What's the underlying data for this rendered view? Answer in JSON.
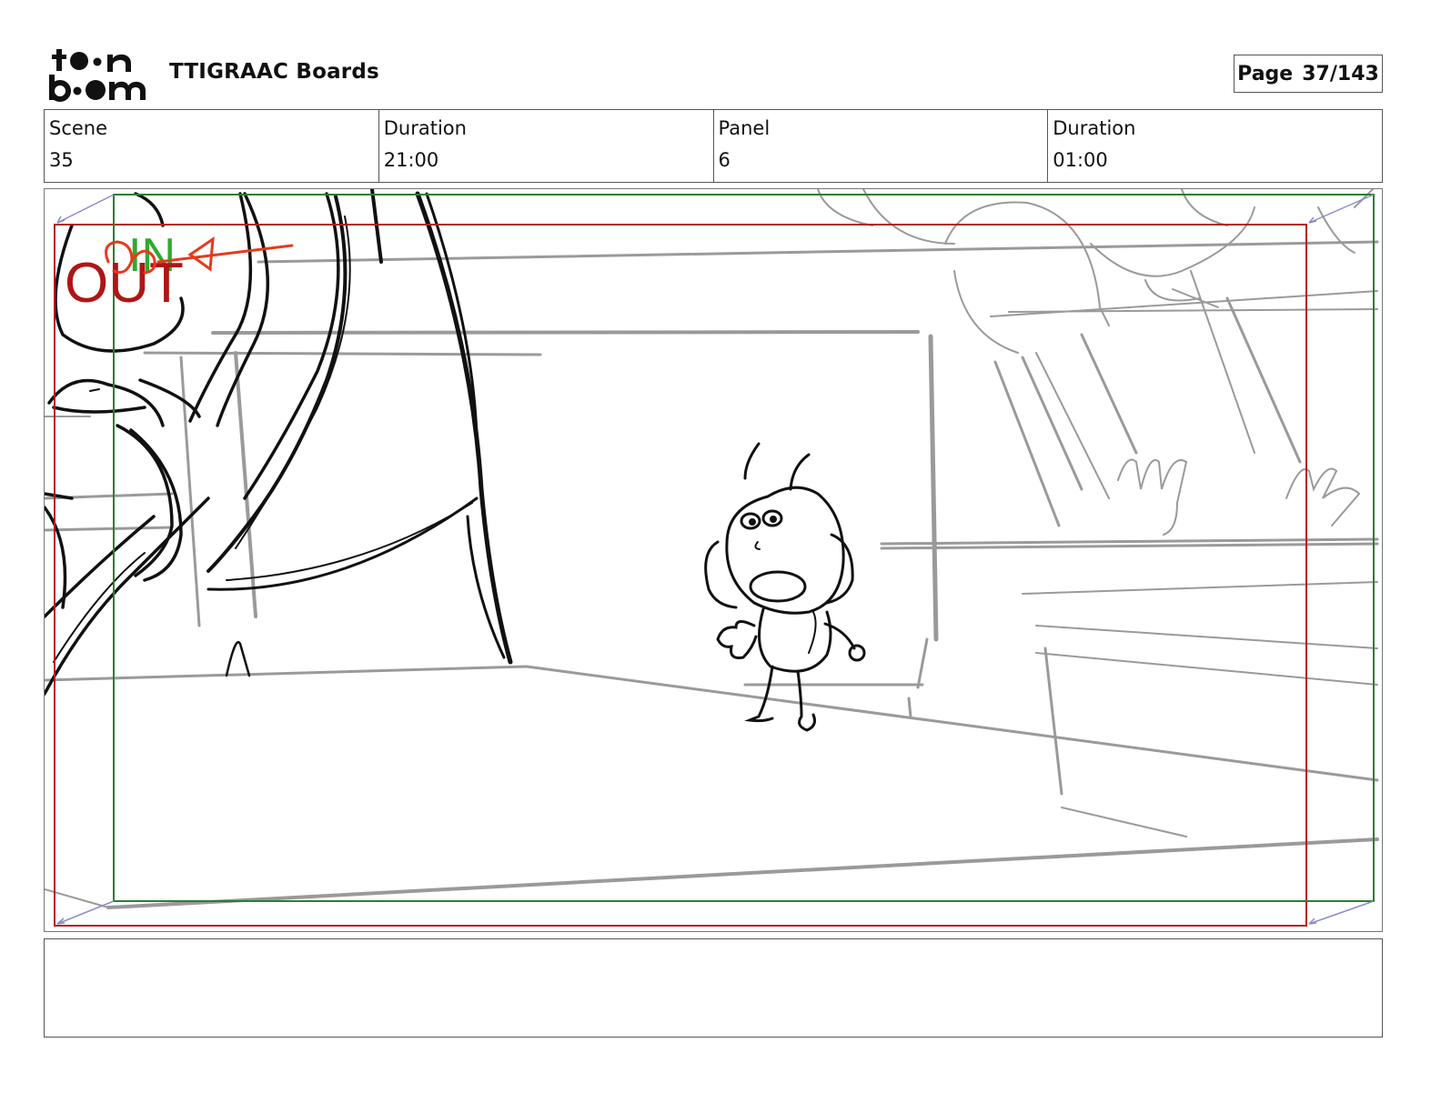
{
  "header": {
    "logo_text": "toon boom",
    "project_title": "TTIGRAAC Boards",
    "page_label": "Page",
    "page_value": "37/143"
  },
  "info": {
    "scene_label": "Scene",
    "scene_value": "35",
    "scene_duration_label": "Duration",
    "scene_duration_value": "21:00",
    "panel_label": "Panel",
    "panel_value": "6",
    "panel_duration_label": "Duration",
    "panel_duration_value": "01:00"
  },
  "panel": {
    "in_label": "IN",
    "out_label": "OUT",
    "colors": {
      "safe_frame": "#2e7d32",
      "camera_frame": "#b71c1c",
      "in_mark": "#2eaa2e",
      "out_mark": "#b01515",
      "arrow": "#e53a1e",
      "sketch_dark": "#111111",
      "sketch_light": "#9a9a9a"
    }
  },
  "notes": {
    "text": ""
  }
}
